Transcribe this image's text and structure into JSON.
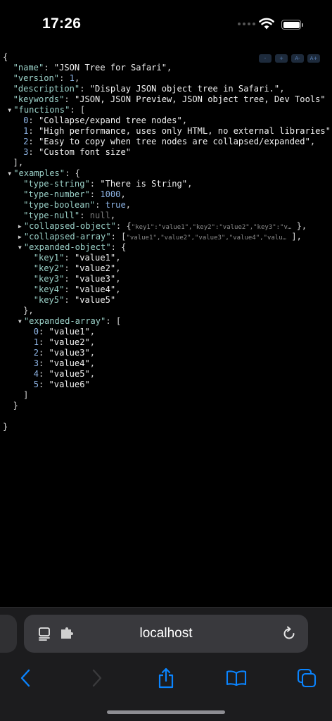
{
  "status_bar": {
    "time": "17:26"
  },
  "font_controls": [
    "-",
    "+",
    "A-",
    "A+"
  ],
  "json_lines": [
    {
      "t": "none",
      "i": 0,
      "parts": [
        [
          "p",
          "{"
        ]
      ]
    },
    {
      "t": "none",
      "i": 1,
      "parts": [
        [
          "k",
          "\"name\""
        ],
        [
          "p",
          ": "
        ],
        [
          "s",
          "\"JSON Tree for Safari\""
        ],
        [
          "p",
          ","
        ]
      ]
    },
    {
      "t": "none",
      "i": 1,
      "parts": [
        [
          "k",
          "\"version\""
        ],
        [
          "p",
          ": "
        ],
        [
          "n",
          "1"
        ],
        [
          "p",
          ","
        ]
      ]
    },
    {
      "t": "none",
      "i": 1,
      "parts": [
        [
          "k",
          "\"description\""
        ],
        [
          "p",
          ": "
        ],
        [
          "s",
          "\"Display JSON object tree in Safari.\""
        ],
        [
          "p",
          ","
        ]
      ]
    },
    {
      "t": "none",
      "i": 1,
      "parts": [
        [
          "k",
          "\"keywords\""
        ],
        [
          "p",
          ": "
        ],
        [
          "s",
          "\"JSON, JSON Preview, JSON object tree, Dev Tools\""
        ]
      ]
    },
    {
      "t": "open",
      "i": 1,
      "parts": [
        [
          "k",
          "\"functions\""
        ],
        [
          "p",
          ": ["
        ]
      ]
    },
    {
      "t": "none",
      "i": 2,
      "parts": [
        [
          "n",
          "0"
        ],
        [
          "p",
          ": "
        ],
        [
          "s",
          "\"Collapse/expand tree nodes\""
        ],
        [
          "p",
          ","
        ]
      ]
    },
    {
      "t": "none",
      "i": 2,
      "parts": [
        [
          "n",
          "1"
        ],
        [
          "p",
          ": "
        ],
        [
          "s",
          "\"High performance, uses only HTML, no external libraries\""
        ]
      ]
    },
    {
      "t": "none",
      "i": 2,
      "parts": [
        [
          "n",
          "2"
        ],
        [
          "p",
          ": "
        ],
        [
          "s",
          "\"Easy to copy when tree nodes are collapsed/expanded\""
        ],
        [
          "p",
          ","
        ]
      ]
    },
    {
      "t": "none",
      "i": 2,
      "parts": [
        [
          "n",
          "3"
        ],
        [
          "p",
          ": "
        ],
        [
          "s",
          "\"Custom font size\""
        ]
      ]
    },
    {
      "t": "none",
      "i": 1,
      "parts": [
        [
          "p",
          "],"
        ]
      ]
    },
    {
      "t": "open",
      "i": 1,
      "parts": [
        [
          "k",
          "\"examples\""
        ],
        [
          "p",
          ": {"
        ]
      ]
    },
    {
      "t": "none",
      "i": 2,
      "parts": [
        [
          "k",
          "\"type-string\""
        ],
        [
          "p",
          ": "
        ],
        [
          "s",
          "\"There is String\""
        ],
        [
          "p",
          ","
        ]
      ]
    },
    {
      "t": "none",
      "i": 2,
      "parts": [
        [
          "k",
          "\"type-number\""
        ],
        [
          "p",
          ": "
        ],
        [
          "n",
          "1000"
        ],
        [
          "p",
          ","
        ]
      ]
    },
    {
      "t": "none",
      "i": 2,
      "parts": [
        [
          "k",
          "\"type-boolean\""
        ],
        [
          "p",
          ": "
        ],
        [
          "b",
          "true"
        ],
        [
          "p",
          ","
        ]
      ]
    },
    {
      "t": "none",
      "i": 2,
      "parts": [
        [
          "k",
          "\"type-null\""
        ],
        [
          "p",
          ": "
        ],
        [
          "u",
          "null"
        ],
        [
          "p",
          ","
        ]
      ]
    },
    {
      "t": "closed",
      "i": 2,
      "parts": [
        [
          "k",
          "\"collapsed-object\""
        ],
        [
          "p",
          ": {"
        ],
        [
          "v",
          "\"key1\":\"value1\",\"key2\":\"value2\",\"key3\":\"v…"
        ],
        [
          "p",
          " },"
        ]
      ]
    },
    {
      "t": "closed",
      "i": 2,
      "parts": [
        [
          "k",
          "\"collapsed-array\""
        ],
        [
          "p",
          ": ["
        ],
        [
          "v",
          "\"value1\",\"value2\",\"value3\",\"value4\",\"valu…"
        ],
        [
          "p",
          " ],"
        ]
      ]
    },
    {
      "t": "open",
      "i": 2,
      "parts": [
        [
          "k",
          "\"expanded-object\""
        ],
        [
          "p",
          ": {"
        ]
      ]
    },
    {
      "t": "none",
      "i": 3,
      "parts": [
        [
          "k",
          "\"key1\""
        ],
        [
          "p",
          ": "
        ],
        [
          "s",
          "\"value1\""
        ],
        [
          "p",
          ","
        ]
      ]
    },
    {
      "t": "none",
      "i": 3,
      "parts": [
        [
          "k",
          "\"key2\""
        ],
        [
          "p",
          ": "
        ],
        [
          "s",
          "\"value2\""
        ],
        [
          "p",
          ","
        ]
      ]
    },
    {
      "t": "none",
      "i": 3,
      "parts": [
        [
          "k",
          "\"key3\""
        ],
        [
          "p",
          ": "
        ],
        [
          "s",
          "\"value3\""
        ],
        [
          "p",
          ","
        ]
      ]
    },
    {
      "t": "none",
      "i": 3,
      "parts": [
        [
          "k",
          "\"key4\""
        ],
        [
          "p",
          ": "
        ],
        [
          "s",
          "\"value4\""
        ],
        [
          "p",
          ","
        ]
      ]
    },
    {
      "t": "none",
      "i": 3,
      "parts": [
        [
          "k",
          "\"key5\""
        ],
        [
          "p",
          ": "
        ],
        [
          "s",
          "\"value5\""
        ]
      ]
    },
    {
      "t": "none",
      "i": 2,
      "parts": [
        [
          "p",
          "},"
        ]
      ]
    },
    {
      "t": "open",
      "i": 2,
      "parts": [
        [
          "k",
          "\"expanded-array\""
        ],
        [
          "p",
          ": ["
        ]
      ]
    },
    {
      "t": "none",
      "i": 3,
      "parts": [
        [
          "n",
          "0"
        ],
        [
          "p",
          ": "
        ],
        [
          "s",
          "\"value1\""
        ],
        [
          "p",
          ","
        ]
      ]
    },
    {
      "t": "none",
      "i": 3,
      "parts": [
        [
          "n",
          "1"
        ],
        [
          "p",
          ": "
        ],
        [
          "s",
          "\"value2\""
        ],
        [
          "p",
          ","
        ]
      ]
    },
    {
      "t": "none",
      "i": 3,
      "parts": [
        [
          "n",
          "2"
        ],
        [
          "p",
          ": "
        ],
        [
          "s",
          "\"value3\""
        ],
        [
          "p",
          ","
        ]
      ]
    },
    {
      "t": "none",
      "i": 3,
      "parts": [
        [
          "n",
          "3"
        ],
        [
          "p",
          ": "
        ],
        [
          "s",
          "\"value4\""
        ],
        [
          "p",
          ","
        ]
      ]
    },
    {
      "t": "none",
      "i": 3,
      "parts": [
        [
          "n",
          "4"
        ],
        [
          "p",
          ": "
        ],
        [
          "s",
          "\"value5\""
        ],
        [
          "p",
          ","
        ]
      ]
    },
    {
      "t": "none",
      "i": 3,
      "parts": [
        [
          "n",
          "5"
        ],
        [
          "p",
          ": "
        ],
        [
          "s",
          "\"value6\""
        ]
      ]
    },
    {
      "t": "none",
      "i": 2,
      "parts": [
        [
          "p",
          "]"
        ]
      ]
    },
    {
      "t": "none",
      "i": 1,
      "parts": [
        [
          "p",
          "}"
        ]
      ]
    },
    {
      "t": "none",
      "i": 0,
      "parts": [
        [
          "p",
          ""
        ]
      ]
    },
    {
      "t": "none",
      "i": 0,
      "parts": [
        [
          "p",
          "}"
        ]
      ]
    }
  ],
  "browser": {
    "url": "localhost"
  },
  "icons": {
    "wifi": "wifi-icon",
    "battery": "battery-icon",
    "reader": "reader-icon",
    "extension": "extension-icon",
    "reload": "reload-icon",
    "back": "back-icon",
    "forward": "forward-icon",
    "share": "share-icon",
    "bookmarks": "bookmarks-icon",
    "tabs": "tabs-icon"
  },
  "colors": {
    "accent": "#0a84ff",
    "key": "#9bd1c8",
    "number": "#8fb6e8",
    "null": "#7a7a7a"
  }
}
